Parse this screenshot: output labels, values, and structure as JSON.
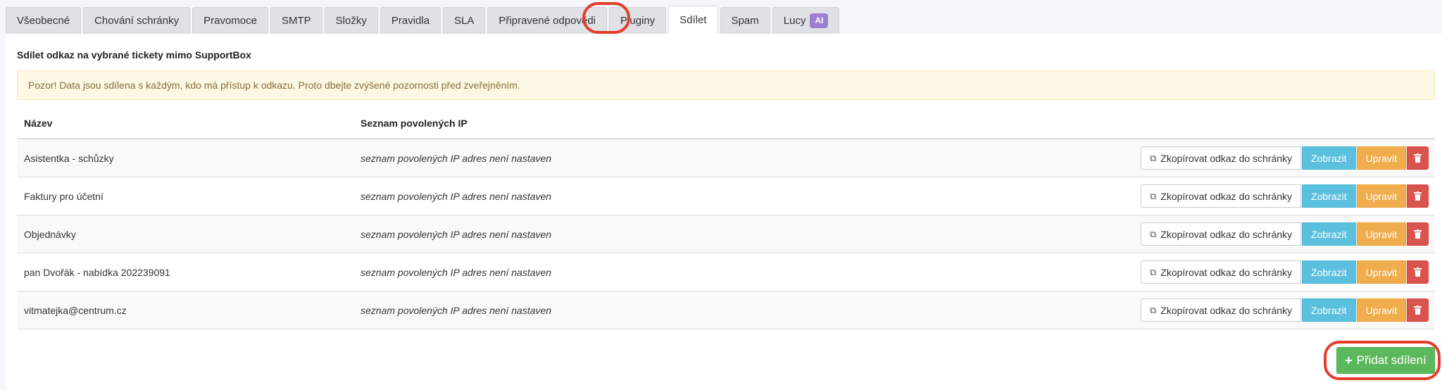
{
  "tabs": [
    {
      "label": "Všeobecné"
    },
    {
      "label": "Chování schránky"
    },
    {
      "label": "Pravomoce"
    },
    {
      "label": "SMTP"
    },
    {
      "label": "Složky"
    },
    {
      "label": "Pravidla"
    },
    {
      "label": "SLA"
    },
    {
      "label": "Připravené odpovědi"
    },
    {
      "label": "Pluginy"
    },
    {
      "label": "Sdílet"
    },
    {
      "label": "Spam"
    },
    {
      "label": "Lucy",
      "badge": "AI"
    }
  ],
  "section": {
    "title": "Sdílet odkaz na vybrané tickety mimo SupportBox",
    "alert": "Pozor! Data jsou sdílena s každým, kdo má přístup k odkazu. Proto dbejte zvýšené pozornosti před zveřejněním."
  },
  "table": {
    "headers": {
      "name": "Název",
      "ip": "Seznam povolených IP"
    },
    "rows": [
      {
        "name": "Asistentka - schůzky",
        "ip": "seznam povolených IP adres není nastaven"
      },
      {
        "name": "Faktury pro účetní",
        "ip": "seznam povolených IP adres není nastaven"
      },
      {
        "name": "Objednávky",
        "ip": "seznam povolených IP adres není nastaven"
      },
      {
        "name": "pan Dvořák - nabídka 202239091",
        "ip": "seznam povolených IP adres není nastaven"
      },
      {
        "name": "vitmatejka@centrum.cz",
        "ip": "seznam povolených IP adres není nastaven"
      }
    ]
  },
  "actions": {
    "copy": "Zkopírovat odkaz do schránky",
    "show": "Zobrazit",
    "edit": "Upravit"
  },
  "add_button": "Přidat sdílení",
  "icons": {
    "copy": "copy-icon",
    "delete": "trash-icon",
    "add": "plus-icon"
  },
  "colors": {
    "highlight": "#e53c2c",
    "info": "#5bc0de",
    "warning": "#f0ad4e",
    "danger": "#d9534f",
    "success": "#5cb85c",
    "ai_badge": "#9b7fd3"
  }
}
